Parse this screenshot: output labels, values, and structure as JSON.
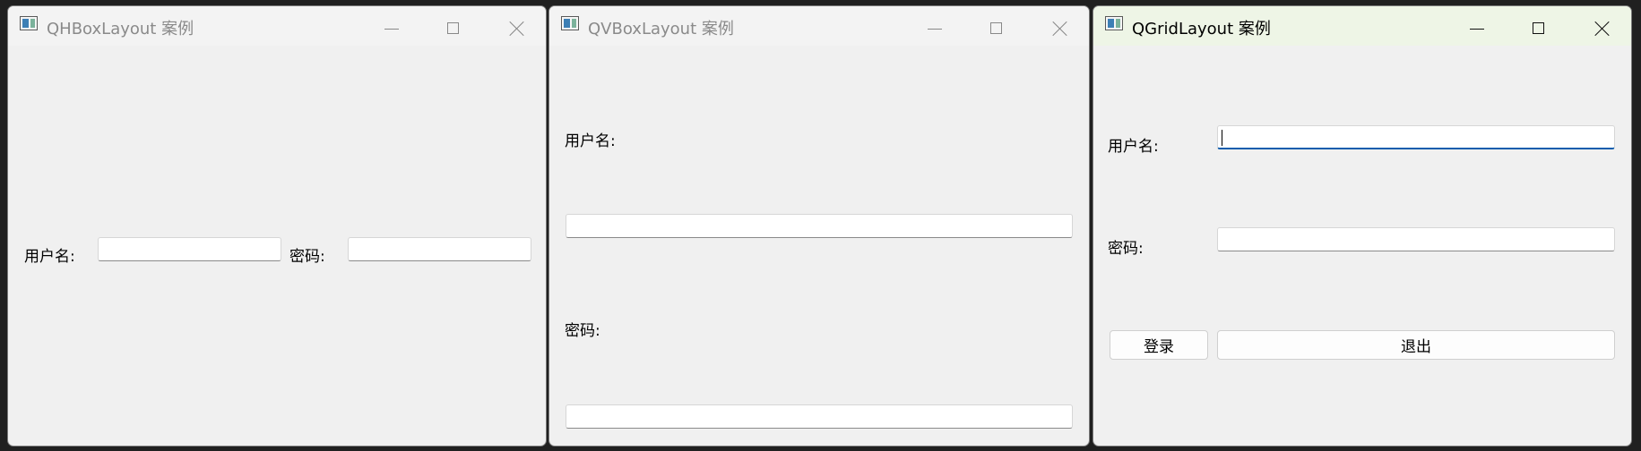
{
  "windows": {
    "hbox": {
      "title": "QHBoxLayout 案例",
      "username_label": "用户名:",
      "password_label": "密码:"
    },
    "vbox": {
      "title": "QVBoxLayout 案例",
      "username_label": "用户名:",
      "password_label": "密码:"
    },
    "grid": {
      "title": "QGridLayout 案例",
      "username_label": "用户名:",
      "password_label": "密码:",
      "login_button": "登录",
      "exit_button": "退出"
    }
  },
  "icons": {
    "app": "qt-app-icon",
    "minimize": "minimize-icon",
    "maximize": "maximize-icon",
    "close": "close-icon"
  },
  "colors": {
    "focus_accent": "#0b5cad",
    "active_titlebar": "#eef5e6"
  }
}
